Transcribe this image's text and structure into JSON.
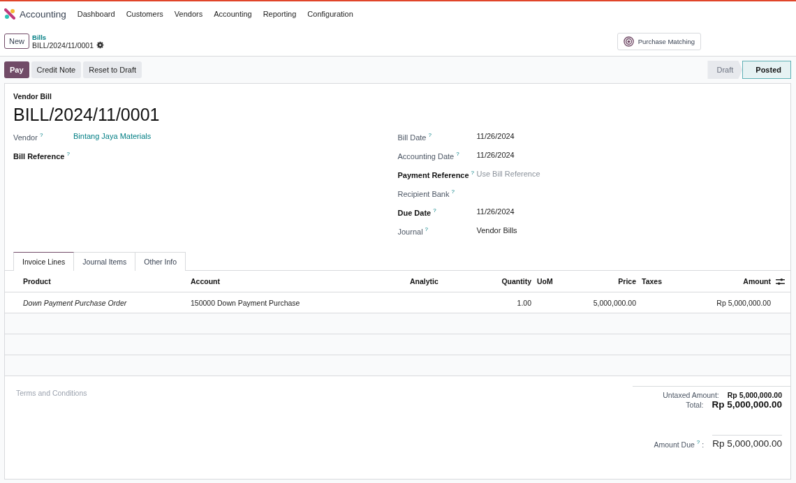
{
  "app": {
    "name": "Accounting"
  },
  "menu": [
    "Dashboard",
    "Customers",
    "Vendors",
    "Accounting",
    "Reporting",
    "Configuration"
  ],
  "control_panel": {
    "new_button": "New",
    "breadcrumb_parent": "Bills",
    "breadcrumb_current": "BILL/2024/11/0001",
    "smart_button": "Purchase Matching"
  },
  "actions": [
    {
      "label": "Pay",
      "kind": "primary"
    },
    {
      "label": "Credit Note",
      "kind": "secondary"
    },
    {
      "label": "Reset to Draft",
      "kind": "secondary"
    }
  ],
  "status_bar": [
    {
      "label": "Draft",
      "selected": false
    },
    {
      "label": "Posted",
      "selected": true
    }
  ],
  "form": {
    "type_label": "Vendor Bill",
    "name": "BILL/2024/11/0001",
    "left_fields": [
      {
        "label": "Vendor",
        "help": "?",
        "required": false,
        "value": "Bintang Jaya Materials",
        "kind": "link"
      },
      {
        "label": "Bill Reference",
        "help": "?",
        "required": true
      }
    ],
    "right_fields": [
      {
        "label": "Bill Date",
        "help": "?",
        "required": false,
        "value": "11/26/2024",
        "kind": "text"
      },
      {
        "label": "Accounting Date",
        "help": "?",
        "required": false,
        "value": "11/26/2024",
        "kind": "text"
      },
      {
        "label": "Payment Reference",
        "help": "?",
        "required": true,
        "placeholder": "Use Bill Reference"
      },
      {
        "label": "Recipient Bank",
        "help": "?",
        "required": false
      },
      {
        "label": "Due Date",
        "help": "?",
        "required": true,
        "value": "11/26/2024",
        "kind": "text"
      },
      {
        "label": "Journal",
        "help": "?",
        "required": false,
        "value": "Vendor Bills",
        "kind": "text"
      }
    ]
  },
  "tabs": [
    {
      "label": "Invoice Lines",
      "selected": true
    },
    {
      "label": "Journal Items",
      "selected": false
    },
    {
      "label": "Other Info",
      "selected": false
    }
  ],
  "table": {
    "columns": [
      "Product",
      "Account",
      "Analytic",
      "Quantity",
      "UoM",
      "Price",
      "Taxes",
      "Amount"
    ],
    "rows": [
      [
        "Down Payment Purchase Order",
        "150000 Down Payment Purchase",
        "",
        "1.00",
        "",
        "5,000,000.00",
        "",
        "Rp 5,000,000.00"
      ]
    ]
  },
  "terms": {
    "placeholder": "Terms and Conditions"
  },
  "totals": [
    {
      "label": "Untaxed Amount:",
      "value": "Rp 5,000,000.00",
      "kind": "subtotal"
    },
    {
      "label": "Total:",
      "value": "Rp 5,000,000.00",
      "kind": "total"
    }
  ],
  "amount_due": {
    "label": "Amount Due",
    "help": "?",
    "colon": ":",
    "value": "Rp 5,000,000.00"
  }
}
